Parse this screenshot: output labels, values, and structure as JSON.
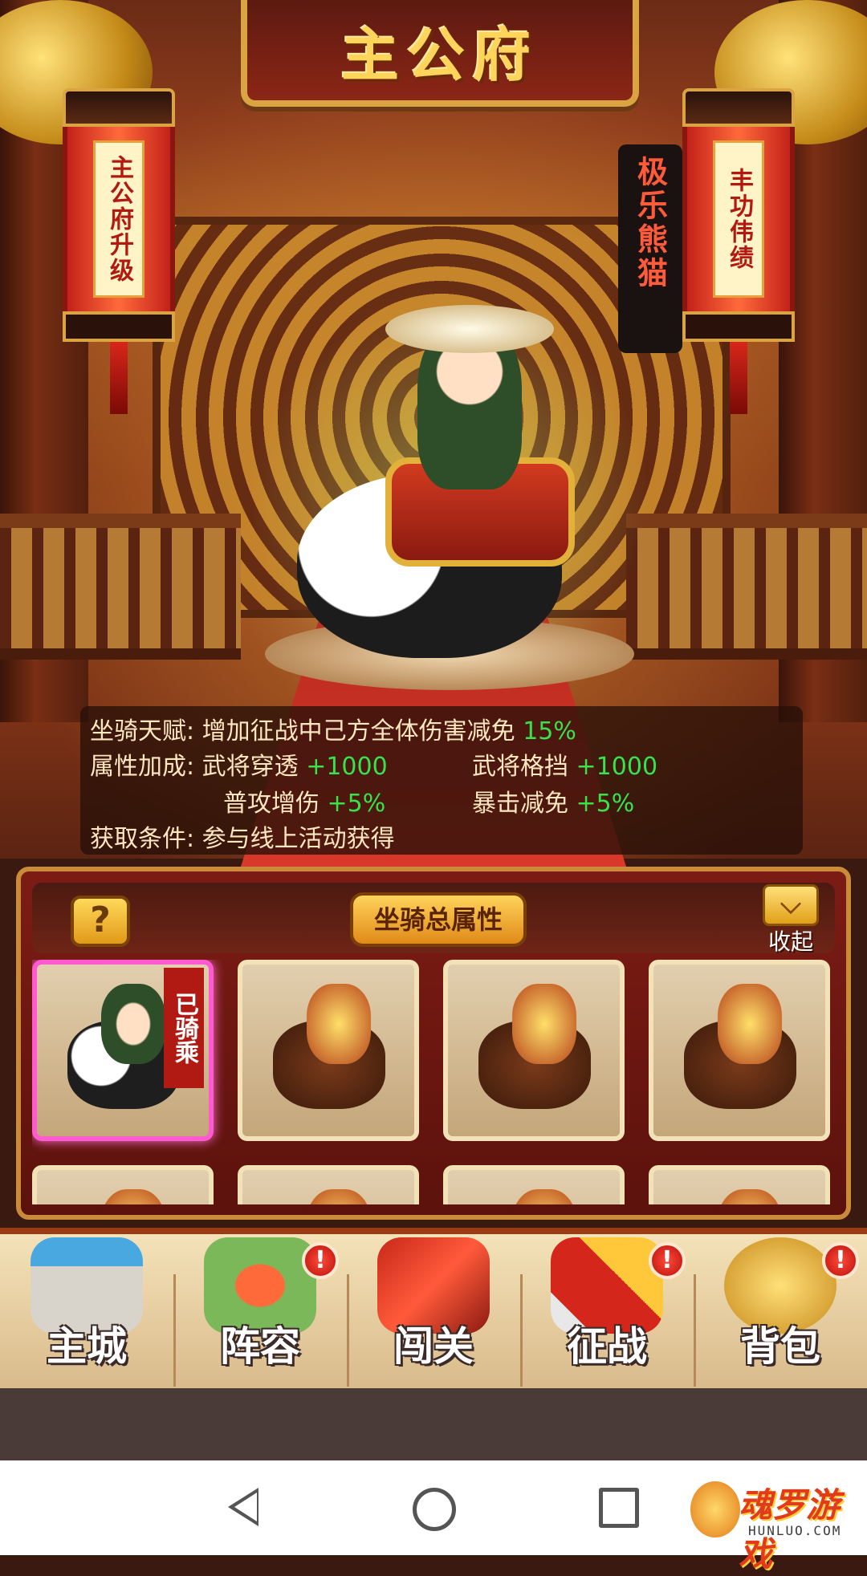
{
  "header": {
    "title": "主公府"
  },
  "lanterns": {
    "left": "主公府升级",
    "right": "丰功伟绩"
  },
  "mount": {
    "name": "极乐熊猫",
    "talent_label": "坐骑天赋:",
    "talent_text": "增加征战中己方全体伤害减免",
    "talent_value": "15%",
    "bonus_label": "属性加成:",
    "bonuses": [
      {
        "name": "武将穿透",
        "value": "+1000"
      },
      {
        "name": "武将格挡",
        "value": "+1000"
      },
      {
        "name": "普攻增伤",
        "value": "+5%"
      },
      {
        "name": "暴击减免",
        "value": "+5%"
      }
    ],
    "acquire_label": "获取条件:",
    "acquire_text": "参与线上活动获得"
  },
  "panel": {
    "help_label": "?",
    "total_attr_label": "坐骑总属性",
    "collapse_label": "收起",
    "riding_badge": "已骑乘"
  },
  "nav": {
    "items": [
      {
        "label": "主城",
        "icon": "city-gate-icon",
        "alert": false
      },
      {
        "label": "阵容",
        "icon": "lineup-icon",
        "alert": true
      },
      {
        "label": "闯关",
        "icon": "banner-scroll-icon",
        "alert": false
      },
      {
        "label": "征战",
        "icon": "crossed-swords-icon",
        "alert": true
      },
      {
        "label": "背包",
        "icon": "bag-icon",
        "alert": true
      }
    ],
    "alert_glyph": "!"
  },
  "watermark": {
    "text": "魂罗游戏",
    "sub": "HUNLUO.COM"
  },
  "colors": {
    "accent_gold": "#ffd45a",
    "bonus_green": "#37e24a",
    "selected_border": "#ff5ad0"
  }
}
